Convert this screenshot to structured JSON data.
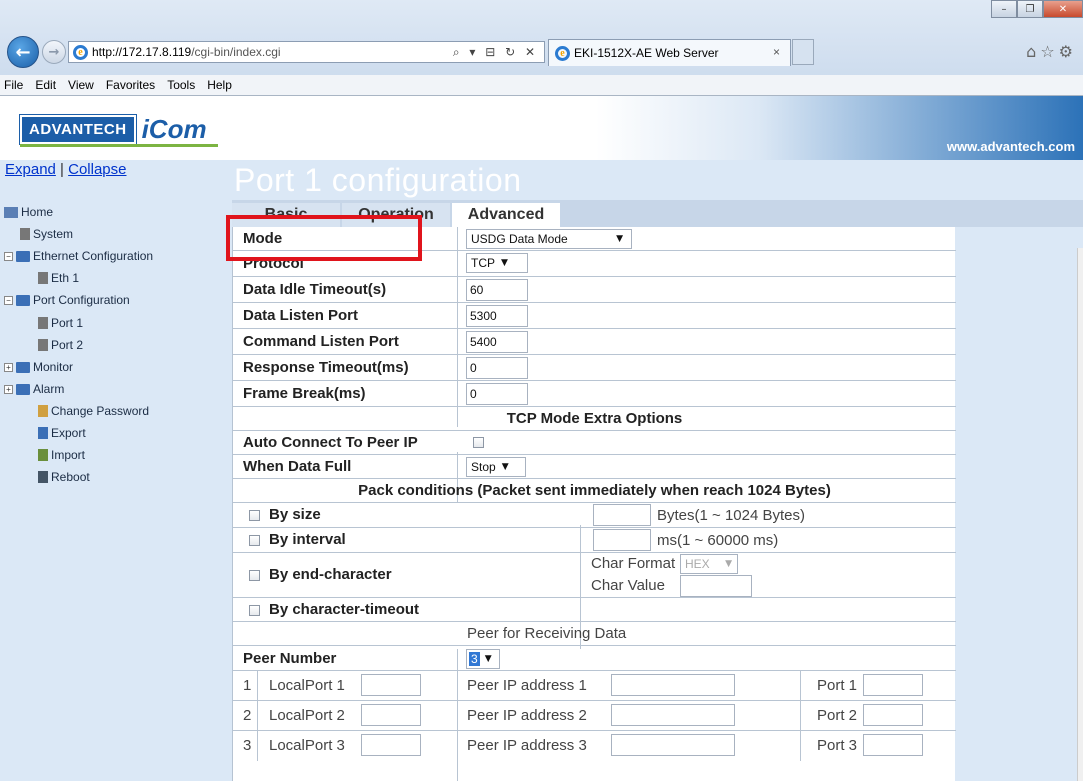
{
  "browser": {
    "address_host": "http://172.17.8.119",
    "address_path": "/cgi-bin/index.cgi",
    "address_tools": "⌕ ▾ ⊟ ↻ ✕",
    "tab_title": "EKI-1512X-AE Web Server",
    "tab_close": "×",
    "menu": [
      "File",
      "Edit",
      "View",
      "Favorites",
      "Tools",
      "Help"
    ],
    "window_buttons": [
      "–",
      "❐",
      "✕"
    ],
    "toolbar_icons": [
      "home-icon",
      "star-icon",
      "gear-icon"
    ]
  },
  "banner": {
    "logo_left": "ADVANTECH",
    "logo_right": "iCom",
    "site": "www.advantech.com",
    "brand_color": "#1c5ea8",
    "accent_color": "#7cb442"
  },
  "sidebar": {
    "expand": "Expand",
    "separator": "|",
    "collapse": "Collapse",
    "items": [
      {
        "label": "Home",
        "icon": "home-icon"
      },
      {
        "label": "System",
        "icon": "system-icon"
      },
      {
        "label": "Ethernet Configuration",
        "icon": "folder-icon",
        "toggle": "−"
      },
      {
        "label": "Eth 1",
        "icon": "wrench-icon"
      },
      {
        "label": "Port Configuration",
        "icon": "folder-icon",
        "toggle": "−"
      },
      {
        "label": "Port 1",
        "icon": "port-icon"
      },
      {
        "label": "Port 2",
        "icon": "port-icon"
      },
      {
        "label": "Monitor",
        "icon": "folder-icon",
        "toggle": "+"
      },
      {
        "label": "Alarm",
        "icon": "folder-icon",
        "toggle": "+"
      },
      {
        "label": "Change Password",
        "icon": "key-icon"
      },
      {
        "label": "Export",
        "icon": "save-icon"
      },
      {
        "label": "Import",
        "icon": "import-icon"
      },
      {
        "label": "Reboot",
        "icon": "reboot-icon"
      }
    ]
  },
  "main": {
    "title": "Port 1 configuration",
    "tabs": [
      "Basic",
      "Operation",
      "Advanced"
    ],
    "fields": {
      "mode_label": "Mode",
      "mode_value": "USDG Data Mode",
      "protocol_label": "Protocol",
      "protocol_value": "TCP",
      "idle_label": "Data Idle Timeout(s)",
      "idle_value": "60",
      "listen_label": "Data Listen Port",
      "listen_value": "5300",
      "cmd_label": "Command Listen Port",
      "cmd_value": "5400",
      "resp_label": "Response Timeout(ms)",
      "resp_value": "0",
      "frame_label": "Frame Break(ms)",
      "frame_value": "0",
      "tcp_header": "TCP Mode Extra Options",
      "auto_label": "Auto Connect To Peer IP",
      "full_label": "When Data Full",
      "full_value": "Stop",
      "pack_header": "Pack conditions (Packet sent immediately when reach 1024 Bytes)",
      "by_size": "By size",
      "by_size_unit": "Bytes(1 ~ 1024 Bytes)",
      "by_interval": "By interval",
      "by_interval_unit": "ms(1 ~ 60000 ms)",
      "by_end": "By end-character",
      "char_format_label": "Char Format",
      "char_format_value": "HEX",
      "char_value_label": "Char Value",
      "by_timeout": "By character-timeout",
      "peer_header": "Peer for Receiving Data",
      "peer_number_label": "Peer Number",
      "peer_number_value": "3"
    },
    "peers": [
      {
        "num": "1",
        "local": "LocalPort 1",
        "ip": "Peer IP address 1",
        "port": "Port 1"
      },
      {
        "num": "2",
        "local": "LocalPort 2",
        "ip": "Peer IP address 2",
        "port": "Port 2"
      },
      {
        "num": "3",
        "local": "LocalPort 3",
        "ip": "Peer IP address 3",
        "port": "Port 3"
      }
    ]
  }
}
